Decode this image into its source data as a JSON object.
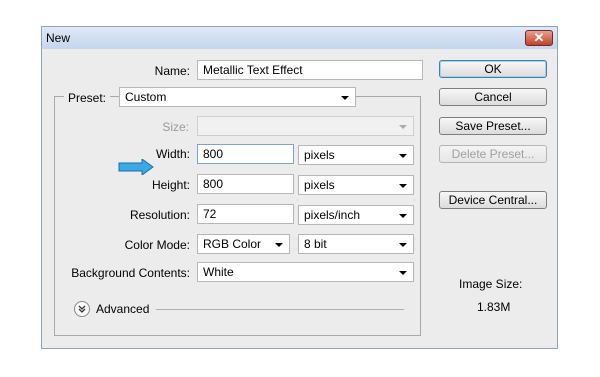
{
  "window": {
    "title": "New",
    "close_label": "✕"
  },
  "form": {
    "name_label": "Name:",
    "name_value": "Metallic Text Effect",
    "preset_label": "Preset:",
    "preset_value": "Custom",
    "size_label": "Size:",
    "size_value": "",
    "width_label": "Width:",
    "width_value": "800",
    "width_unit": "pixels",
    "height_label": "Height:",
    "height_value": "800",
    "height_unit": "pixels",
    "resolution_label": "Resolution:",
    "resolution_value": "72",
    "resolution_unit": "pixels/inch",
    "color_mode_label": "Color Mode:",
    "color_mode_value": "RGB Color",
    "bit_depth_value": "8 bit",
    "background_label": "Background Contents:",
    "background_value": "White",
    "advanced_label": "Advanced"
  },
  "buttons": {
    "ok": "OK",
    "cancel": "Cancel",
    "save_preset": "Save Preset...",
    "delete_preset": "Delete Preset...",
    "device_central": "Device Central..."
  },
  "image_size": {
    "label": "Image Size:",
    "value": "1.83M"
  },
  "colors": {
    "arrow": "#3aa9e6",
    "title_bar": "#c4d5ec",
    "dialog_bg": "#ececec"
  }
}
